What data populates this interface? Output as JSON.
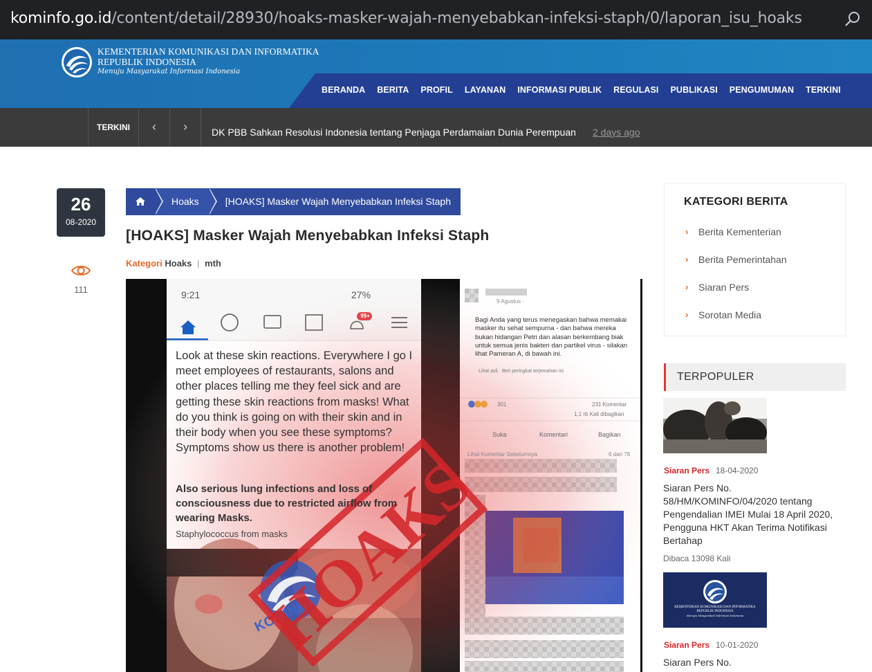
{
  "browser": {
    "url_host": "kominfo.go.id",
    "url_path": "/content/detail/28930/hoaks-masker-wajah-menyebabkan-infeksi-staph/0/laporan_isu_hoaks"
  },
  "header": {
    "brand_line1": "KEMENTERIAN KOMUNIKASI DAN INFORMATIKA",
    "brand_line2": "REPUBLIK INDONESIA",
    "brand_tagline": "Menuju Masyarakat Informasi Indonesia",
    "nav": [
      "BERANDA",
      "BERITA",
      "PROFIL",
      "LAYANAN",
      "INFORMASI PUBLIK",
      "REGULASI",
      "PUBLIKASI",
      "PENGUMUMAN",
      "TERKINI"
    ]
  },
  "ticker": {
    "label": "TERKINI",
    "prev": "‹",
    "next": "›",
    "headline": "DK PBB Sahkan Resolusi Indonesia tentang Penjaga Perdamaian Dunia Perempuan",
    "time_ago": "2 days ago"
  },
  "article": {
    "day": "26",
    "month_year": "08-2020",
    "views": "111",
    "breadcrumb": [
      "Hoaks",
      "[HOAKS] Masker Wajah Menyebabkan Infeksi Staph"
    ],
    "title": "[HOAKS] Masker Wajah Menyebabkan Infeksi Staph",
    "category_label": "Kategori",
    "category": "Hoaks",
    "separator": "|",
    "author": "mth",
    "image": {
      "status_time": "9:21",
      "battery": "27%",
      "badge": "99+",
      "post_text": "Look at these skin reactions. Everywhere I go I meet employees of restaurants, salons and other places telling me they feel sick and are getting these skin reactions from masks! What do you think is going on with their skin and in their body when you see these symptoms? Symptoms show us there is another problem!",
      "post_text2": "Also serious lung infections and loss of consciousness due to restricted airflow from wearing Masks.",
      "post_text3": "Staphylococcus from masks",
      "stamp": "HOAKS",
      "watermark": "KOMINFO",
      "fb_date": "9 Agustus · ",
      "fb_text": "Bagi Anda yang terus menegaskan bahwa memakai masker itu sehat sempurna - dan bahwa mereka bukan hidangan Petri dan alasan berkembang biak untuk semua jenis bakteri dan partikel virus - silakan lihat Pameran A, di bawah ini.",
      "fb_seeoriginal": "Lihat asli · Beri peringkat terjemahan ini",
      "fb_reactions": "301",
      "fb_comments": "231 Komentar",
      "fb_shares": "1,1 rb Kali dibagikan",
      "fb_like": "Suka",
      "fb_comment_btn": "Komentari",
      "fb_share_btn": "Bagikan",
      "fb_prev": "Lihat Komentar Sebelumnya",
      "fb_count": "6 dari 78"
    }
  },
  "sidebar": {
    "category_title": "KATEGORI BERITA",
    "categories": [
      "Berita Kementerian",
      "Berita Pemerintahan",
      "Siaran Pers",
      "Sorotan Media"
    ],
    "popular_title": "TERPOPULER",
    "popular": [
      {
        "category": "Siaran Pers",
        "date": "18-04-2020",
        "title": "Siaran Pers No. 58/HM/KOMINFO/04/2020 tentang Pengendalian IMEI Mulai 18 April 2020, Pengguna HKT Akan Terima Notifikasi Bertahap",
        "reads": "Dibaca 13098 Kali"
      },
      {
        "category": "Siaran Pers",
        "date": "10-01-2020",
        "title": "Siaran Pers No.",
        "thumb_line1": "KEMENTERIAN KOMUNIKASI DAN INFORMATIKA",
        "thumb_line2": "REPUBLIK INDONESIA",
        "thumb_line3": "Menuju Masyarakat Informasi Indonesia"
      }
    ]
  }
}
